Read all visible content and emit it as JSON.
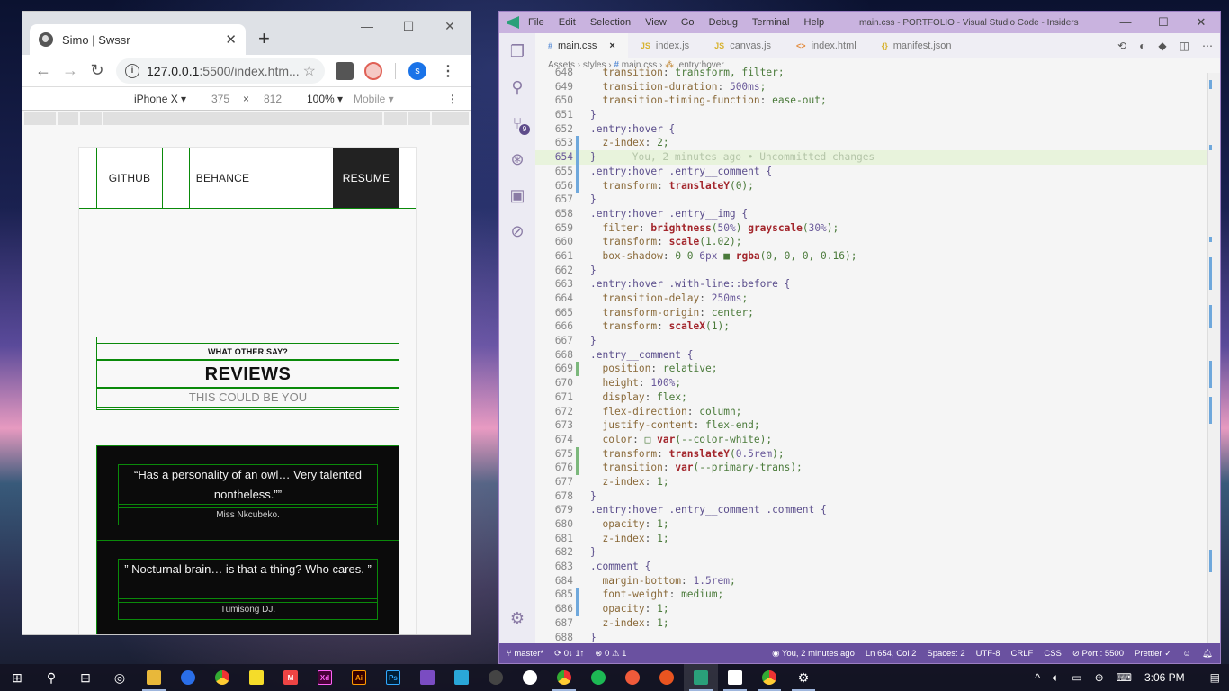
{
  "browser": {
    "tab_title": "Simo | Swssr",
    "tab_close": "✕",
    "new_tab": "+",
    "window_controls": [
      "—",
      "☐",
      "✕"
    ],
    "nav": {
      "back": "←",
      "forward": "→",
      "reload": "↻"
    },
    "url_host": "127.0.0.1",
    "url_rest": ":5500/index.htm...",
    "star_icon": "☆",
    "profile_initial": "s",
    "menu": "⋮",
    "device_toolbar": {
      "device": "iPhone X ▾",
      "width": "375",
      "times": "×",
      "height": "812",
      "zoom": "100% ▾",
      "mode": "Mobile ▾",
      "more": "⋮"
    }
  },
  "site": {
    "nav": {
      "github": "GITHUB",
      "behance": "BEHANCE",
      "resume": "RESUME"
    },
    "reviews": {
      "kicker": "WHAT OTHER SAY?",
      "title": "REVIEWS",
      "tagline": "THIS COULD BE YOU",
      "items": [
        {
          "quote": "“Has a personality of an owl… Very talented nontheless.””",
          "author": "Miss Nkcubeko."
        },
        {
          "quote": "” Nocturnal brain… is that a thing? Who cares. ”",
          "author": "Tumisong DJ."
        }
      ]
    },
    "accent_color": "#0a8a0a"
  },
  "vscode": {
    "menu": [
      "File",
      "Edit",
      "Selection",
      "View",
      "Go",
      "Debug",
      "Terminal",
      "Help"
    ],
    "title": "main.css - PORTFOLIO - Visual Studio Code - Insiders",
    "window_controls": [
      "—",
      "☐",
      "✕"
    ],
    "tabs": [
      {
        "icon": "#",
        "label": "main.css",
        "active": true
      },
      {
        "icon": "JS",
        "label": "index.js"
      },
      {
        "icon": "JS",
        "label": "canvas.js"
      },
      {
        "icon": "<>",
        "label": "index.html"
      },
      {
        "icon": "{}",
        "label": "manifest.json"
      }
    ],
    "tab_close": "×",
    "breadcrumbs": {
      "a": "Assets",
      "b": "styles",
      "c": "main.css",
      "d": ".entry:hover",
      "sep": "›"
    },
    "git_badge": "9",
    "code_lines": [
      {
        "n": "648",
        "text": "  transition: transform, filter;"
      },
      {
        "n": "649",
        "text": "  transition-duration: 500ms;"
      },
      {
        "n": "650",
        "text": "  transition-timing-function: ease-out;"
      },
      {
        "n": "651",
        "text": "}"
      },
      {
        "n": "652",
        "text": ".entry:hover {"
      },
      {
        "n": "653",
        "text": "  z-index: 2;"
      },
      {
        "n": "654",
        "text": "}"
      },
      {
        "n": "655",
        "text": ".entry:hover .entry__comment {"
      },
      {
        "n": "656",
        "text": "  transform: translateY(0);"
      },
      {
        "n": "657",
        "text": "}"
      },
      {
        "n": "658",
        "text": ".entry:hover .entry__img {"
      },
      {
        "n": "659",
        "text": "  filter: brightness(50%) grayscale(30%);"
      },
      {
        "n": "660",
        "text": "  transform: scale(1.02);"
      },
      {
        "n": "661",
        "text": "  box-shadow: 0 0 6px ■ rgba(0, 0, 0, 0.16);"
      },
      {
        "n": "662",
        "text": "}"
      },
      {
        "n": "663",
        "text": ".entry:hover .with-line::before {"
      },
      {
        "n": "664",
        "text": "  transition-delay: 250ms;"
      },
      {
        "n": "665",
        "text": "  transform-origin: center;"
      },
      {
        "n": "666",
        "text": "  transform: scaleX(1);"
      },
      {
        "n": "667",
        "text": "}"
      },
      {
        "n": "668",
        "text": ".entry__comment {"
      },
      {
        "n": "669",
        "text": "  position: relative;"
      },
      {
        "n": "670",
        "text": "  height: 100%;"
      },
      {
        "n": "671",
        "text": "  display: flex;"
      },
      {
        "n": "672",
        "text": "  flex-direction: column;"
      },
      {
        "n": "673",
        "text": "  justify-content: flex-end;"
      },
      {
        "n": "674",
        "text": "  color: □ var(--color-white);"
      },
      {
        "n": "675",
        "text": "  transform: translateY(0.5rem);"
      },
      {
        "n": "676",
        "text": "  transition: var(--primary-trans);"
      },
      {
        "n": "677",
        "text": "  z-index: 1;"
      },
      {
        "n": "678",
        "text": "}"
      },
      {
        "n": "679",
        "text": ".entry:hover .entry__comment .comment {"
      },
      {
        "n": "680",
        "text": "  opacity: 1;"
      },
      {
        "n": "681",
        "text": "  z-index: 1;"
      },
      {
        "n": "682",
        "text": "}"
      },
      {
        "n": "683",
        "text": ".comment {"
      },
      {
        "n": "684",
        "text": "  margin-bottom: 1.5rem;"
      },
      {
        "n": "685",
        "text": "  font-weight: medium;"
      },
      {
        "n": "686",
        "text": "  opacity: 1;"
      },
      {
        "n": "687",
        "text": "  z-index: 1;"
      },
      {
        "n": "688",
        "text": "}"
      }
    ],
    "blame_ghost": "You, 2 minutes ago • Uncommitted changes",
    "status": {
      "branch": "master*",
      "sync": "0↓ 1↑",
      "errors": "⊗ 0",
      "warnings": "⚠ 1",
      "blame": "You, 2 minutes ago",
      "position": "Ln 654, Col 2",
      "spaces": "Spaces: 2",
      "encoding": "UTF-8",
      "eol": "CRLF",
      "language": "CSS",
      "port": "Port : 5500",
      "prettier": "Prettier ✓"
    },
    "status_color": "#6a51a0"
  },
  "taskbar": {
    "clock": "3:06 PM",
    "apps": [
      "start",
      "search",
      "task-view",
      "groove",
      "file-explorer",
      "firefox",
      "chrome",
      "sticky-notes",
      "gmail",
      "adobe-xd",
      "illustrator",
      "photoshop",
      "visual-studio",
      "app-blue",
      "obs",
      "mongodb",
      "chrome-2",
      "spotify",
      "app-orange",
      "ubuntu",
      "vscode-insiders",
      "photos",
      "chrome-canary",
      "settings"
    ]
  }
}
